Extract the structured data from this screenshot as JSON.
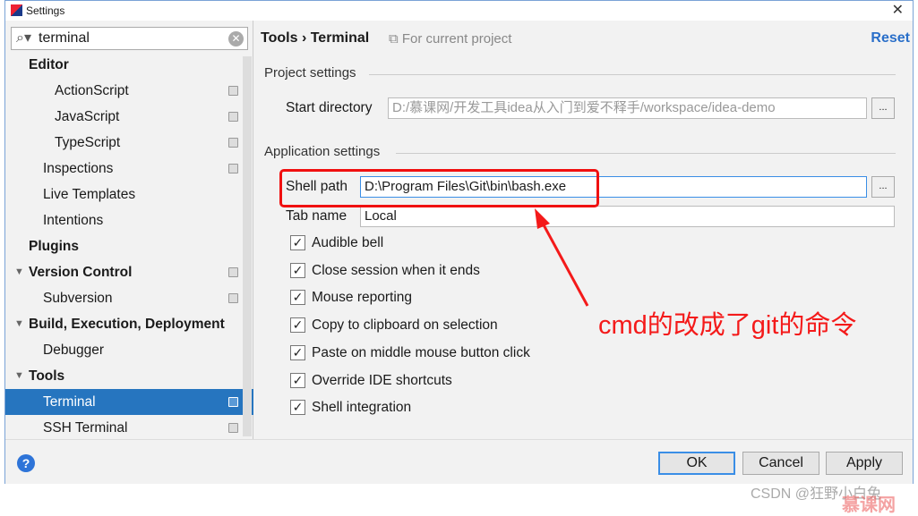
{
  "window": {
    "title": "Settings",
    "close": "✕"
  },
  "search": {
    "value": "terminal"
  },
  "sidebar": {
    "items": [
      {
        "label": "Editor",
        "level": 0,
        "bold": true
      },
      {
        "label": "ActionScript",
        "level": 2,
        "copy": true
      },
      {
        "label": "JavaScript",
        "level": 2,
        "copy": true
      },
      {
        "label": "TypeScript",
        "level": 2,
        "copy": true
      },
      {
        "label": "Inspections",
        "level": 1,
        "copy": true
      },
      {
        "label": "Live Templates",
        "level": 1
      },
      {
        "label": "Intentions",
        "level": 1
      },
      {
        "label": "Plugins",
        "level": 0,
        "bold": true
      },
      {
        "label": "Version Control",
        "level": 0,
        "bold": true,
        "expanded": true,
        "copy": true
      },
      {
        "label": "Subversion",
        "level": 1,
        "copy": true
      },
      {
        "label": "Build, Execution, Deployment",
        "level": 0,
        "bold": true,
        "expanded": true
      },
      {
        "label": "Debugger",
        "level": 1
      },
      {
        "label": "Tools",
        "level": 0,
        "bold": true,
        "expanded": true
      },
      {
        "label": "Terminal",
        "level": 1,
        "copy": true,
        "selected": true
      },
      {
        "label": "SSH Terminal",
        "level": 1,
        "copy": true
      }
    ]
  },
  "header": {
    "crumb1": "Tools",
    "sep": "›",
    "crumb2": "Terminal",
    "scope": "For current project",
    "reset": "Reset"
  },
  "project_settings": {
    "title": "Project settings",
    "start_dir_label": "Start directory",
    "start_dir_value": "D:/慕课网/开发工具idea从入门到爱不释手/workspace/idea-demo"
  },
  "app_settings": {
    "title": "Application settings",
    "shell_label": "Shell path",
    "shell_value": "D:\\Program Files\\Git\\bin\\bash.exe",
    "tab_label": "Tab name",
    "tab_value": "Local",
    "checkboxes": [
      {
        "label": "Audible bell",
        "checked": true
      },
      {
        "label": "Close session when it ends",
        "checked": true
      },
      {
        "label": "Mouse reporting",
        "checked": true
      },
      {
        "label": "Copy to clipboard on selection",
        "checked": true
      },
      {
        "label": "Paste on middle mouse button click",
        "checked": true
      },
      {
        "label": "Override IDE shortcuts",
        "checked": true
      },
      {
        "label": "Shell integration",
        "checked": true
      }
    ]
  },
  "browse": "...",
  "buttons": {
    "help": "?",
    "ok": "OK",
    "cancel": "Cancel",
    "apply": "Apply"
  },
  "annotation": {
    "text": "cmd的改成了git的命令",
    "color": "#f41a1a"
  },
  "watermark": "CSDN @狂野小白兔",
  "logo": "慕课网",
  "colors": {
    "selection": "#2675bf",
    "link": "#2a6fc9"
  }
}
